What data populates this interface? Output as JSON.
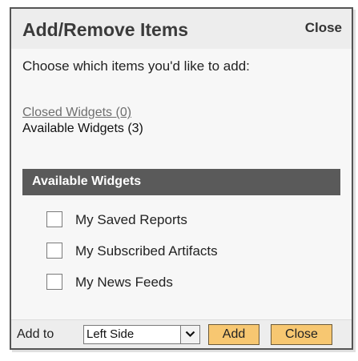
{
  "dialog": {
    "title": "Add/Remove Items",
    "close_label": "Close",
    "intro_text": "Choose which items you'd like to add:",
    "closed_widgets_link": "Closed Widgets (0)",
    "available_widgets_link": "Available Widgets (3)",
    "section_title": "Available Widgets",
    "widgets": [
      {
        "label": "My Saved Reports",
        "checked": false
      },
      {
        "label": "My Subscribed Artifacts",
        "checked": false
      },
      {
        "label": "My News Feeds",
        "checked": false
      }
    ]
  },
  "footer": {
    "add_to_label": "Add to",
    "position_select": {
      "selected": "Left Side",
      "icon": "chevron-down-icon"
    },
    "add_button": "Add",
    "close_button": "Close"
  },
  "colors": {
    "header_bg": "#ededed",
    "section_bar_bg": "#5a5a5a",
    "button_bg": "#f7c771",
    "border": "#555555"
  }
}
